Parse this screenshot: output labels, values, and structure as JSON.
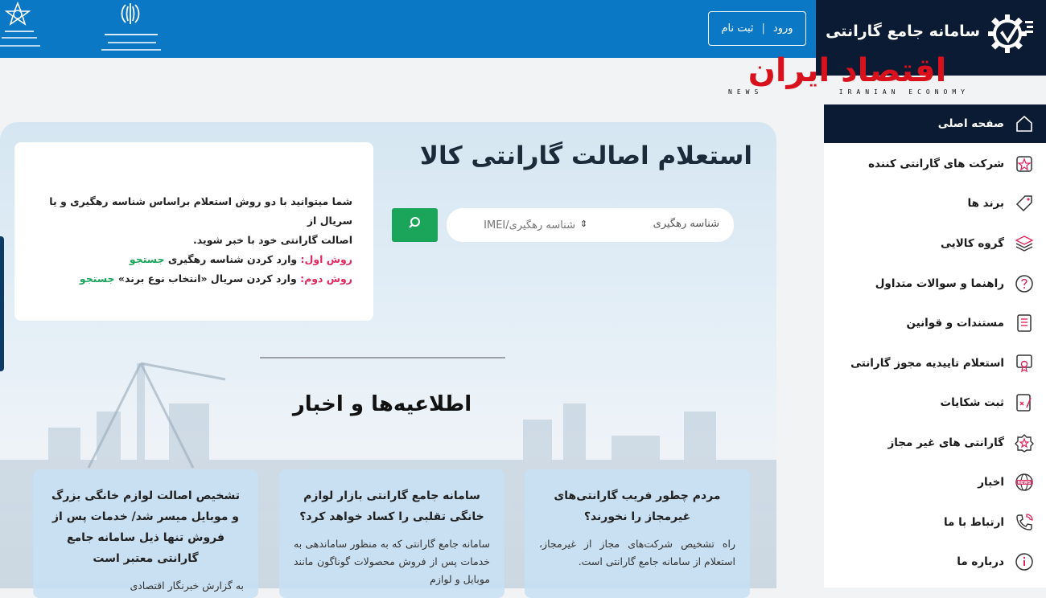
{
  "header": {
    "login": "ورود",
    "separator": "|",
    "register": "ثبت نام"
  },
  "brand": {
    "title": "سامانه جامع گارانتی"
  },
  "watermark": {
    "title": "اقتصاد ایران",
    "news": "NEWS",
    "subtitle": "IRANIAN ECONOMY"
  },
  "sidebar": {
    "items": [
      {
        "label": "صفحه اصلی",
        "icon": "home-icon"
      },
      {
        "label": "شرکت های گارانتی کننده",
        "icon": "badge-star-icon"
      },
      {
        "label": "برند ها",
        "icon": "tag-icon"
      },
      {
        "label": "گروه کالایی",
        "icon": "layers-icon"
      },
      {
        "label": "راهنما و سوالات متداول",
        "icon": "question-icon"
      },
      {
        "label": "مستندات و قوانین",
        "icon": "document-list-icon"
      },
      {
        "label": "استعلام تاییدیه مجوز گارانتی",
        "icon": "certificate-icon"
      },
      {
        "label": "ثبت شکایات",
        "icon": "complaint-icon"
      },
      {
        "label": "گارانتی های غیر مجاز",
        "icon": "warning-badge-icon"
      },
      {
        "label": "اخبار",
        "icon": "news-globe-icon"
      },
      {
        "label": "ارتباط با ما",
        "icon": "phone-icon"
      },
      {
        "label": "درباره ما",
        "icon": "info-icon"
      }
    ]
  },
  "main": {
    "title": "استعلام اصالت گارانتی کالا",
    "search": {
      "select_value": "شناسه رهگیری",
      "placeholder": "شناسه رهگیری/IMEI",
      "arrows": "⇕"
    },
    "info": {
      "line1": "شما میتوانید با دو روش استعلام براساس شناسه رهگیری و یا سریال از",
      "line2": "اصالت گارانتی خود با خبر شوید.",
      "method1_label": "روش اول:",
      "method1_text": " وارد کردن شناسه رهگیری ",
      "method1_link": "جستجو",
      "method2_label": "روش دوم:",
      "method2_text": " وارد کردن سریال «انتخاب نوع برند» ",
      "method2_link": "جستجو"
    },
    "news_heading": "اطلاعیه‌ها و اخبار"
  },
  "news": [
    {
      "title": "مردم چطور فریب گارانتی‌های غیرمجاز را نخورند؟",
      "text": "راه تشخیص شرکت‌های مجاز از غیرمجاز، استعلام از سامانه جامع گارانتی است."
    },
    {
      "title": "سامانه جامع گارانتی بازار لوازم خانگی تقلبی را کساد خواهد کرد؟",
      "text": "سامانه جامع گارانتی که به منظور ساماندهی به خدمات پس از فروش محصولات گوناگون مانند موبایل و لوازم"
    },
    {
      "title": "تشخیص اصالت لوازم خانگی بزرگ و موبایل میسر شد/ خدمات پس از فروش تنها ذیل سامانه جامع گارانتی معتبر است",
      "text": "به گزارش خبرنگار اقتصادی"
    }
  ],
  "colors": {
    "topbar": "#0a78c4",
    "navy": "#0b1b33",
    "green": "#1aa55b",
    "pink": "#e0285e",
    "red": "#d9111d"
  }
}
